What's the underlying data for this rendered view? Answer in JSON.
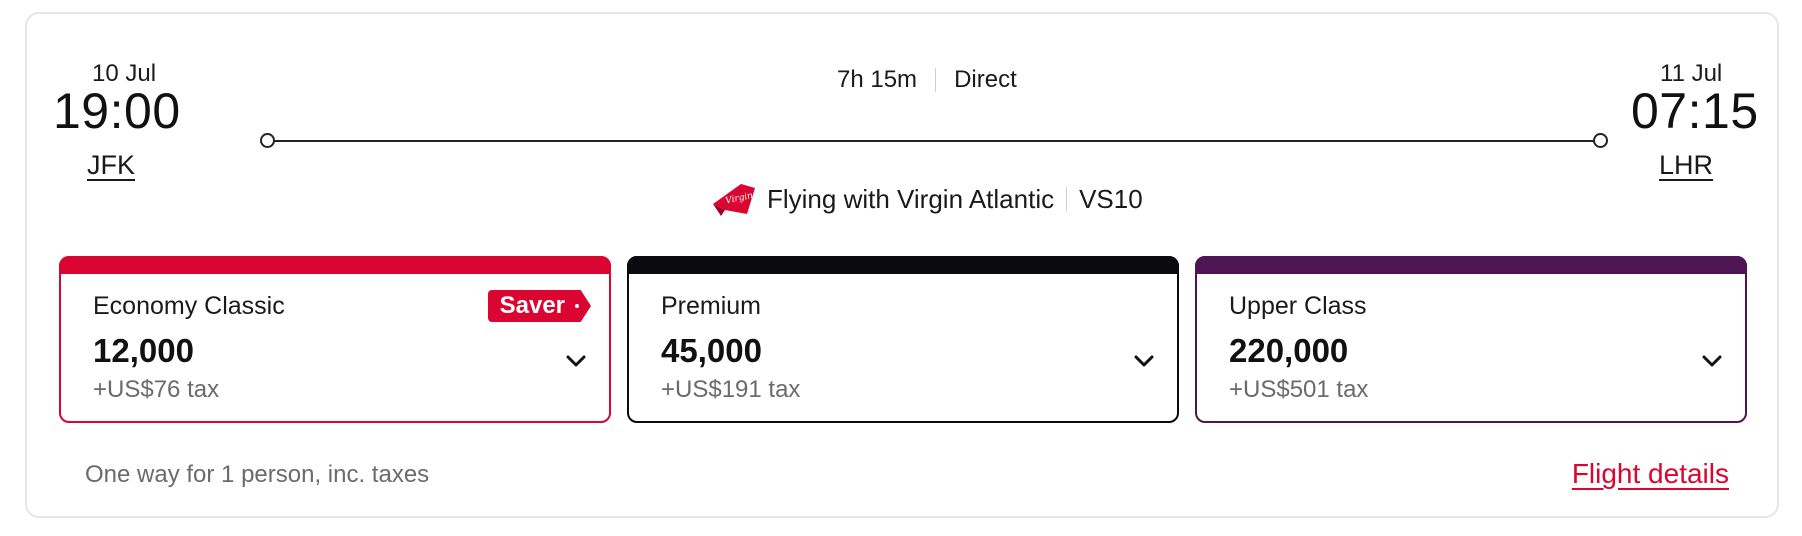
{
  "flight": {
    "departure": {
      "date": "10 Jul",
      "time": "19:00",
      "airport": "JFK"
    },
    "arrival": {
      "date": "11 Jul",
      "time": "07:15",
      "airport": "LHR"
    },
    "duration": "7h 15m",
    "stops": "Direct",
    "operator_text": "Flying with Virgin Atlantic",
    "flight_number": "VS10",
    "logo_icon": "virgin-atlantic-logo-icon"
  },
  "fares": [
    {
      "name": "Economy Classic",
      "points": "12,000",
      "tax": "+US$76 tax",
      "badge": "Saver",
      "color": "#da0530"
    },
    {
      "name": "Premium",
      "points": "45,000",
      "tax": "+US$191 tax",
      "color": "#0a0a0f"
    },
    {
      "name": "Upper Class",
      "points": "220,000",
      "tax": "+US$501 tax",
      "color": "#4f1454"
    }
  ],
  "footer": {
    "note": "One way for 1 person, inc. taxes",
    "details_link": "Flight details"
  },
  "colors": {
    "accent": "#da0530"
  }
}
